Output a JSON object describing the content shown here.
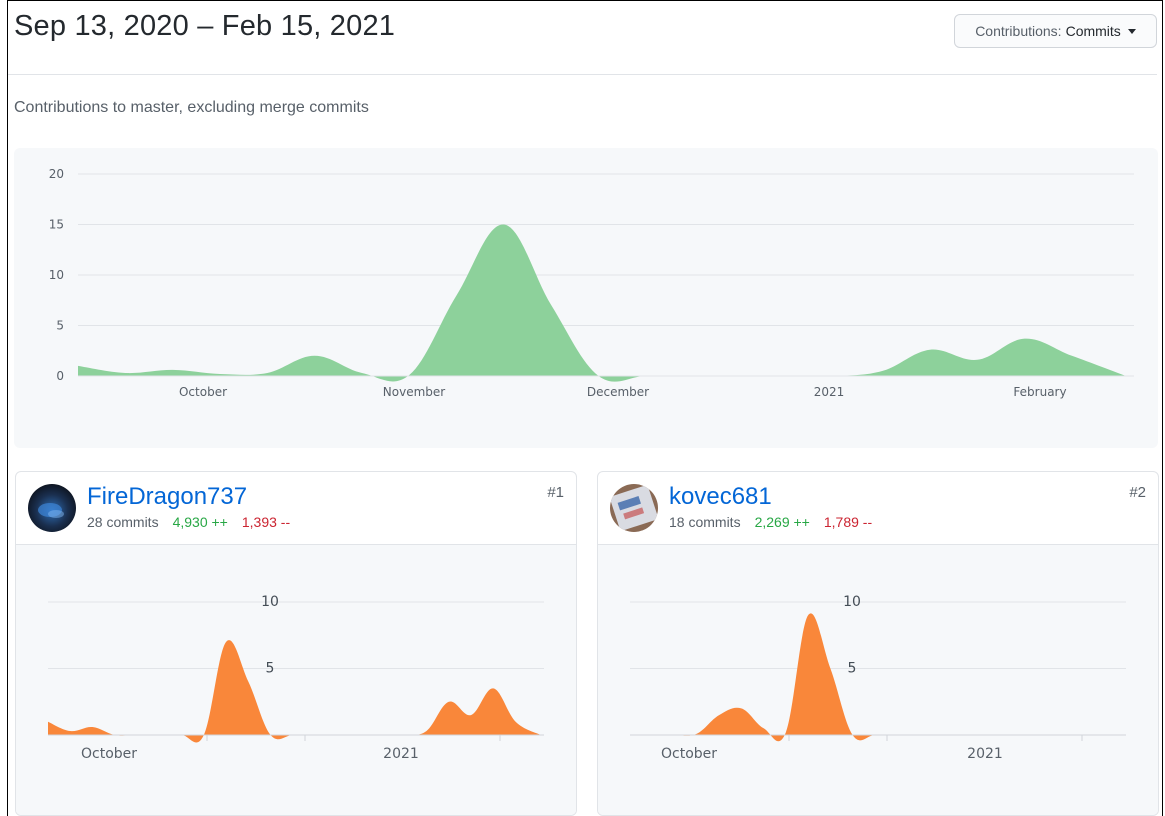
{
  "header": {
    "date_range": "Sep 13, 2020 – Feb 15, 2021",
    "dropdown_label": "Contributions:",
    "dropdown_value": "Commits"
  },
  "subtitle": "Contributions to master, excluding merge commits",
  "colors": {
    "main_area": "#8dd19b",
    "contributor_area": "#f9873a",
    "link": "#0366d6",
    "additions": "#28a745",
    "deletions": "#cb2431"
  },
  "chart_data": [
    {
      "type": "area",
      "title": "",
      "ylim": [
        0,
        20
      ],
      "yticks": [
        "0",
        "5",
        "10",
        "15",
        "20"
      ],
      "xticks": [
        "October",
        "November",
        "December",
        "2021",
        "February"
      ],
      "x": [
        "2020-09-13",
        "2020-09-20",
        "2020-09-27",
        "2020-10-04",
        "2020-10-11",
        "2020-10-18",
        "2020-10-25",
        "2020-11-01",
        "2020-11-08",
        "2020-11-15",
        "2020-11-22",
        "2020-11-29",
        "2020-12-06",
        "2020-12-13",
        "2020-12-20",
        "2020-12-27",
        "2021-01-03",
        "2021-01-10",
        "2021-01-17",
        "2021-01-24",
        "2021-01-31",
        "2021-02-07",
        "2021-02-15"
      ],
      "values": [
        1,
        0.3,
        0.6,
        0.2,
        0.3,
        2,
        0.3,
        0.1,
        8,
        15,
        7,
        0,
        0,
        0,
        0,
        0,
        0,
        0.5,
        2.6,
        1.6,
        3.7,
        2,
        0
      ],
      "grid": true
    },
    {
      "type": "area",
      "series_owner": "FireDragon737",
      "ylim": [
        0,
        11
      ],
      "yticks": [
        "5",
        "10"
      ],
      "xticks": [
        "October",
        "2021"
      ],
      "x": [
        "2020-09-13",
        "2020-09-20",
        "2020-09-27",
        "2020-10-04",
        "2020-10-11",
        "2020-10-18",
        "2020-10-25",
        "2020-11-01",
        "2020-11-08",
        "2020-11-15",
        "2020-11-22",
        "2020-11-29",
        "2020-12-06",
        "2020-12-13",
        "2020-12-20",
        "2020-12-27",
        "2021-01-03",
        "2021-01-10",
        "2021-01-17",
        "2021-01-24",
        "2021-01-31",
        "2021-02-07",
        "2021-02-15"
      ],
      "values": [
        1,
        0.3,
        0.6,
        0,
        0,
        0,
        0,
        0,
        7,
        4,
        0,
        0,
        0,
        0,
        0,
        0,
        0,
        0.3,
        2.5,
        1.5,
        3.5,
        1,
        0
      ]
    },
    {
      "type": "area",
      "series_owner": "kovec681",
      "ylim": [
        0,
        11
      ],
      "yticks": [
        "5",
        "10"
      ],
      "xticks": [
        "October",
        "2021"
      ],
      "x": [
        "2020-09-13",
        "2020-09-20",
        "2020-09-27",
        "2020-10-04",
        "2020-10-11",
        "2020-10-18",
        "2020-10-25",
        "2020-11-01",
        "2020-11-08",
        "2020-11-15",
        "2020-11-22",
        "2020-11-29",
        "2020-12-06",
        "2020-12-13",
        "2020-12-20",
        "2020-12-27",
        "2021-01-03",
        "2021-01-10",
        "2021-01-17",
        "2021-01-24",
        "2021-01-31",
        "2021-02-07",
        "2021-02-15"
      ],
      "values": [
        0,
        0,
        0,
        0.1,
        1.5,
        2,
        0.5,
        0.2,
        9,
        5,
        0,
        0,
        0,
        0,
        0,
        0,
        0,
        0,
        0,
        0,
        0,
        0,
        0
      ]
    }
  ],
  "contributors": [
    {
      "name": "FireDragon737",
      "commits": "28 commits",
      "additions": "4,930 ++",
      "deletions": "1,393 --",
      "rank": "#1"
    },
    {
      "name": "kovec681",
      "commits": "18 commits",
      "additions": "2,269 ++",
      "deletions": "1,789 --",
      "rank": "#2"
    }
  ]
}
